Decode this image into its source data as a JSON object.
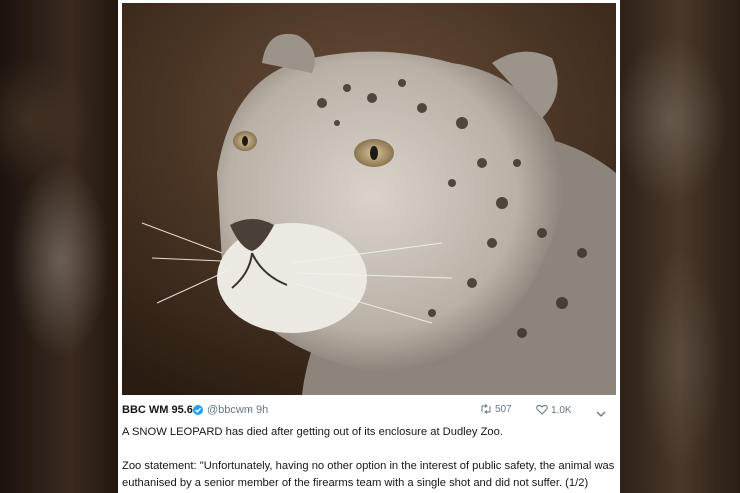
{
  "image": {
    "subject": "snow-leopard-photo"
  },
  "tweet": {
    "name": "BBC WM 95.6",
    "handle": "@bbcwm",
    "separator": "·",
    "time": "9h",
    "retweets": "507",
    "likes": "1.0K",
    "line1": "A SNOW LEOPARD has died after getting out of its enclosure at Dudley Zoo.",
    "line2": "Zoo statement: \"Unfortunately, having no other option in the interest of public safety, the animal was euthanised by a senior member of the firearms team with a single shot and did not suffer. (1/2)"
  },
  "colors": {
    "verified": "#1da1f2",
    "text": "#14171a",
    "muted": "#657786"
  }
}
